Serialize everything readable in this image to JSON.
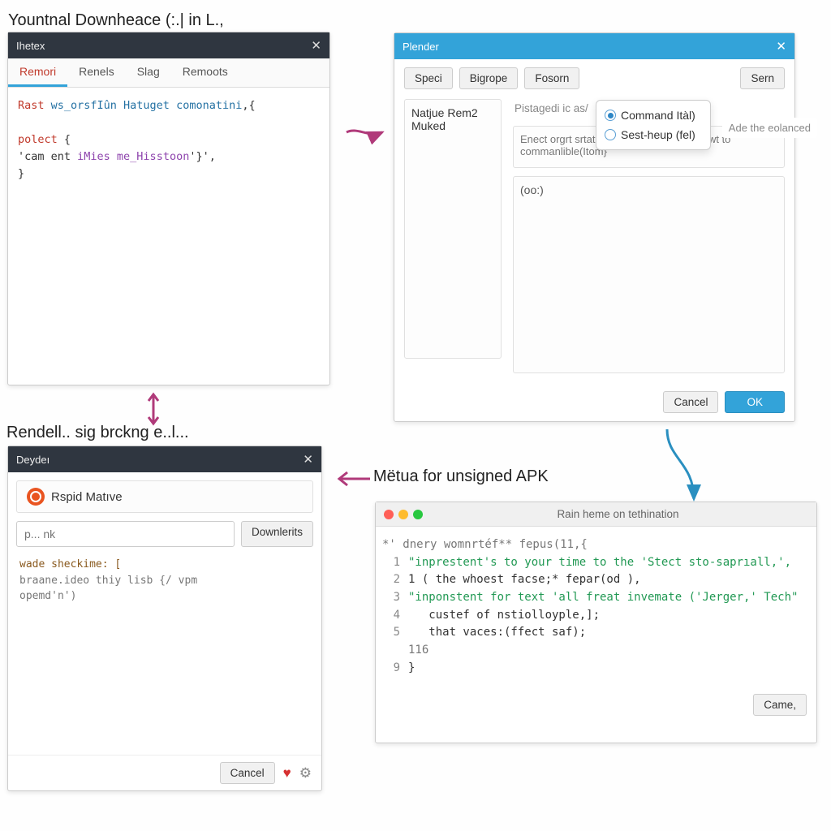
{
  "headings": {
    "top": "Yountnal Downheace (:.| in L.,",
    "mid": "Rendell.. sig brckng e..l...",
    "apk": "Mëtua for unsigned APK"
  },
  "w1": {
    "title": "Ihetex",
    "tabs": [
      "Remori",
      "Renels",
      "Slag",
      "Remoots"
    ],
    "active_tab_index": 0,
    "code": {
      "l1a": "Rast ",
      "l1b": "ws_orsfIûn Hatuget comonatini",
      "l1c": ",{",
      "l2a": "polect",
      "l2b": " {",
      "l3a": "'cam ent ",
      "l3b": "iMies me_Hisstoon",
      "l3c": "'}',",
      "l4": "}"
    }
  },
  "w2": {
    "title": "Plender",
    "toolbar": [
      "Speci",
      "Bigrope",
      "Fosorn"
    ],
    "right_btn": "Sern",
    "ghost": "Ade the eolanced",
    "left_panel": [
      "Natjue Rem2",
      "Muked"
    ],
    "right_header": "Pistagedi ic as/",
    "desc": "Enect orgrt srtato Is gr aogh, onit to uelewt to commanlible(Itom}",
    "out": "(oo:)",
    "radios": [
      "Command Itàl)",
      "Sest-heup (fel)"
    ],
    "radio_selected": 0,
    "cancel": "Cancel",
    "ok": "OK"
  },
  "w3": {
    "title": "Deydeı",
    "chip": "Rspid Matıve",
    "placeholder": "p... nk",
    "dl_btn": "Downlerits",
    "body": {
      "l1": "wade  sheckime: [",
      "l2": "   braane.ideo thiy lisb {/ vpm",
      "l3": "   opemd'n')"
    },
    "cancel": "Cancel"
  },
  "w4": {
    "title": "Rain heme on tethination",
    "lines": {
      "pre": "*' dnery womnrtéf** fepus(11,{",
      "l1": "\"inprestent's to your time to the 'Stect sto-saprıall,',",
      "l2": "1 ( the whoest facse;* fepar(od ),",
      "l3": "\"inponstent for text 'all freat invemate ('Jerger,' Tech\"",
      "l4": "   custef of nstiolloyple,];",
      "l5": "   that vaces:(ffect saf);",
      "l6": "116",
      "l7": "}"
    },
    "btn": "Came,"
  }
}
